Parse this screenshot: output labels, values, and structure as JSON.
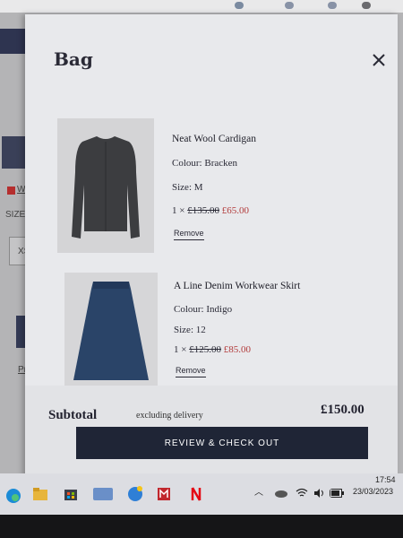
{
  "bag": {
    "title": "Bag",
    "items": [
      {
        "name": "Neat Wool Cardigan",
        "colour": "Colour: Bracken",
        "size": "Size: M",
        "qty": "1 ×",
        "original_price": "£135.00",
        "sale_price": "£65.00",
        "remove_label": "Remove"
      },
      {
        "name": "A Line Denim Workwear Skirt",
        "colour": "Colour: Indigo",
        "size": "Size: 12",
        "qty": "1 ×",
        "original_price": "£125.00",
        "sale_price": "£85.00",
        "remove_label": "Remove"
      }
    ],
    "subtotal_label": "Subtotal",
    "subtotal_note": "excluding delivery",
    "subtotal_value": "£150.00",
    "checkout_label": "REVIEW & CHECK OUT"
  },
  "background": {
    "size_label": "SIZE:",
    "size_value": "XS",
    "link_fragment": "Wh",
    "product_fragment": "Prod"
  },
  "taskbar": {
    "time": "17:54",
    "date": "23/03/2023"
  },
  "colors": {
    "accent_navy": "#1f2536",
    "sale_red": "#b23b3b"
  }
}
